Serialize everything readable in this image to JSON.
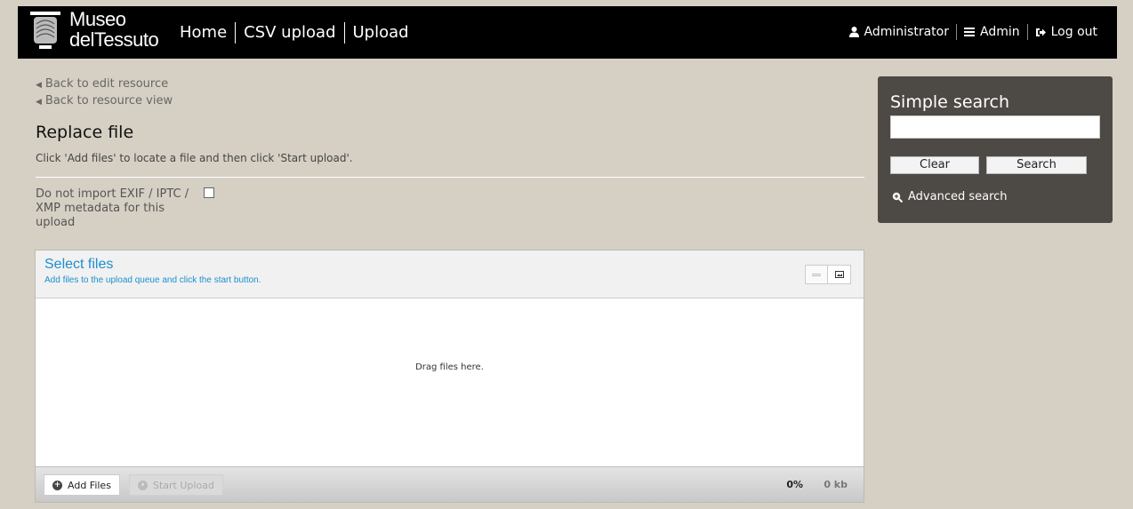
{
  "header": {
    "logo_line1": "Museo",
    "logo_line2_prefix": "del",
    "logo_line2_bold": "Tessuto",
    "nav": [
      {
        "label": "Home"
      },
      {
        "label": "CSV upload"
      },
      {
        "label": "Upload"
      }
    ],
    "user": {
      "name": "Administrator",
      "admin": "Admin",
      "logout": "Log out"
    }
  },
  "main": {
    "back_edit": "Back to edit resource",
    "back_view": "Back to resource view",
    "title": "Replace file",
    "instructions": "Click 'Add files' to locate a file and then click 'Start upload'.",
    "exif_label": "Do not import EXIF / IPTC / XMP metadata for this upload",
    "exif_checked": false
  },
  "uploader": {
    "title": "Select files",
    "subtitle": "Add files to the upload queue and click the start button.",
    "drop_text": "Drag files here.",
    "add_label": "Add Files",
    "start_label": "Start Upload",
    "percent": "0%",
    "size": "0 kb"
  },
  "search": {
    "title": "Simple search",
    "input_value": "",
    "clear_label": "Clear",
    "search_label": "Search",
    "advanced_label": "Advanced search"
  },
  "colors": {
    "background": "#d6d0c4",
    "header": "#000000",
    "accent_blue": "#1c8fcf",
    "search_panel": "#4d4945"
  }
}
